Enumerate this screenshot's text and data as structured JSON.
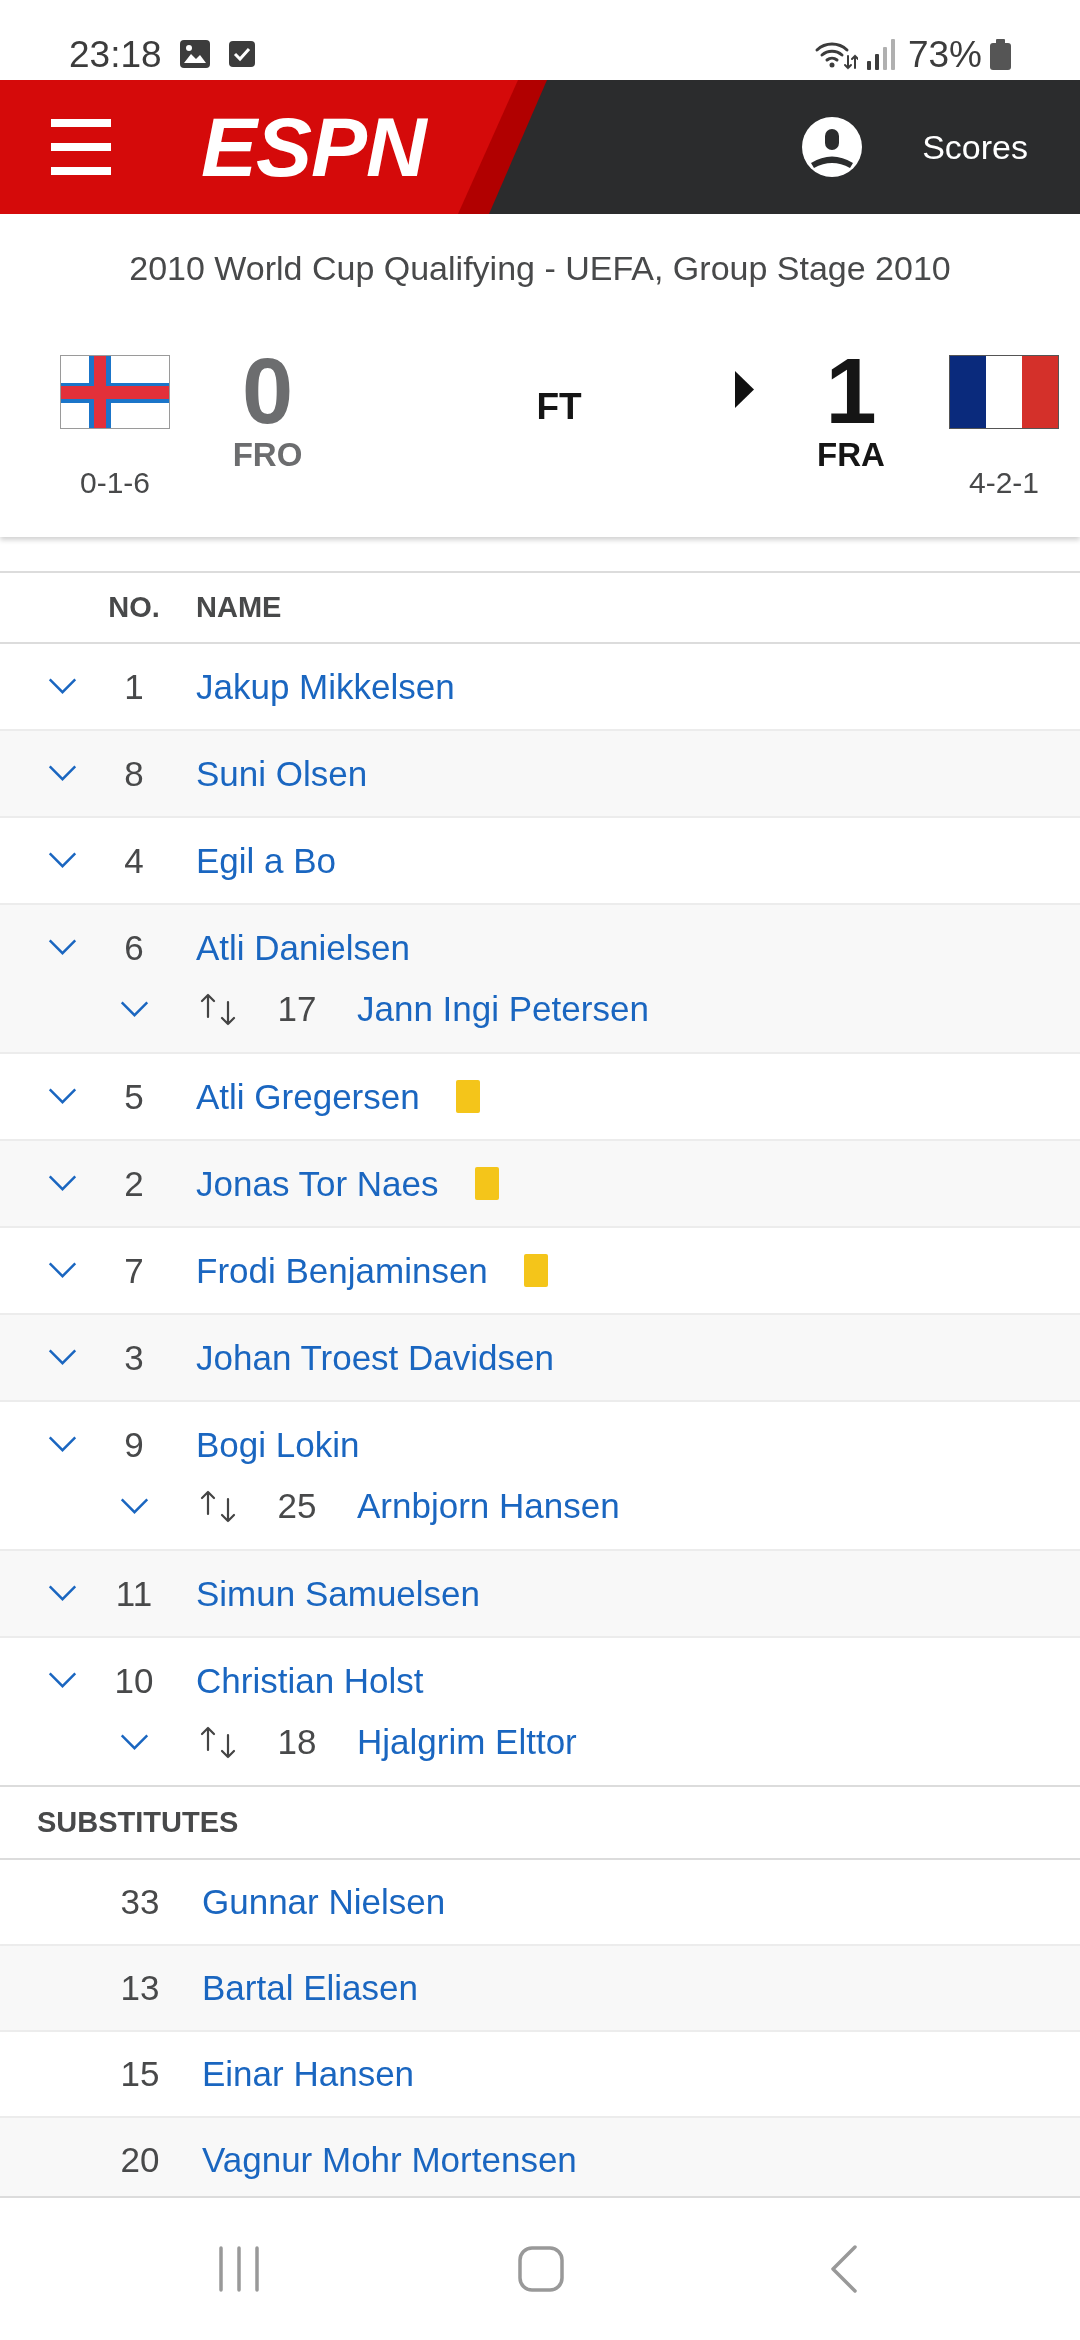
{
  "status_bar": {
    "time": "23:18",
    "battery": "73%"
  },
  "header": {
    "logo": "ESPN",
    "scores_link": "Scores"
  },
  "match": {
    "competition": "2010 World Cup Qualifying - UEFA, Group Stage 2010",
    "status": "FT",
    "teams": [
      {
        "score": "0",
        "abbr": "FRO",
        "record": "0-1-6",
        "winner": false
      },
      {
        "score": "1",
        "abbr": "FRA",
        "record": "4-2-1",
        "winner": true
      }
    ]
  },
  "lineup": {
    "columns": [
      "NO.",
      "NAME"
    ],
    "starters": [
      {
        "expanded": false,
        "number": "1",
        "name": "Jakup Mikkelsen",
        "yellow_card": false
      },
      {
        "expanded": false,
        "number": "8",
        "name": "Suni Olsen",
        "yellow_card": false
      },
      {
        "expanded": false,
        "number": "4",
        "name": "Egil a Bo",
        "yellow_card": false
      },
      {
        "expanded": false,
        "number": "6",
        "name": "Atli Danielsen",
        "yellow_card": false,
        "substituted_by": {
          "expanded": false,
          "number": "17",
          "name": "Jann Ingi Petersen",
          "yellow_card": false
        }
      },
      {
        "expanded": false,
        "number": "5",
        "name": "Atli Gregersen",
        "yellow_card": true
      },
      {
        "expanded": false,
        "number": "2",
        "name": "Jonas Tor Naes",
        "yellow_card": true
      },
      {
        "expanded": false,
        "number": "7",
        "name": "Frodi Benjaminsen",
        "yellow_card": true
      },
      {
        "expanded": false,
        "number": "3",
        "name": "Johan Troest Davidsen",
        "yellow_card": false
      },
      {
        "expanded": false,
        "number": "9",
        "name": "Bogi Lokin",
        "yellow_card": false,
        "substituted_by": {
          "expanded": false,
          "number": "25",
          "name": "Arnbjorn Hansen",
          "yellow_card": false
        }
      },
      {
        "expanded": false,
        "number": "11",
        "name": "Simun Samuelsen",
        "yellow_card": false
      },
      {
        "expanded": false,
        "number": "10",
        "name": "Christian Holst",
        "yellow_card": false,
        "substituted_by": {
          "expanded": false,
          "number": "18",
          "name": "Hjalgrim Elttor",
          "yellow_card": false
        }
      }
    ],
    "substitutes_heading": "SUBSTITUTES",
    "substitutes": [
      {
        "number": "33",
        "name": "Gunnar Nielsen"
      },
      {
        "number": "13",
        "name": "Bartal Eliasen"
      },
      {
        "number": "15",
        "name": "Einar Hansen"
      },
      {
        "number": "20",
        "name": "Vagnur Mohr Mortensen"
      }
    ]
  }
}
